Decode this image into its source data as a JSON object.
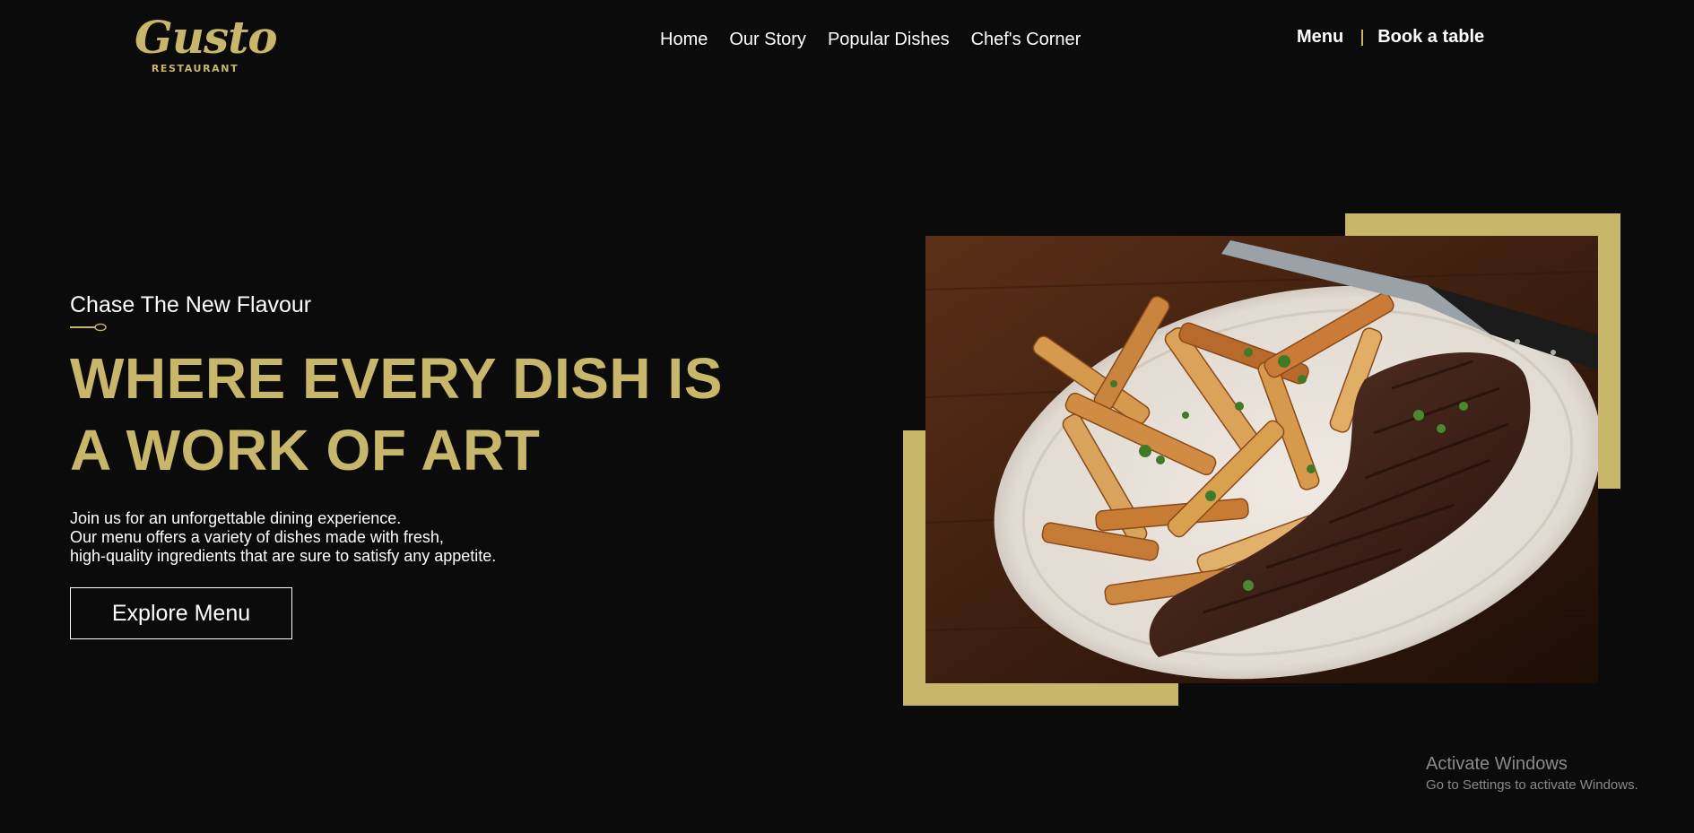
{
  "brand": {
    "name": "Gusto",
    "subtitle": "RESTAURANT",
    "accent_color": "#c8b76a",
    "background_color": "#0b0b0b"
  },
  "nav": {
    "items": [
      {
        "label": "Home"
      },
      {
        "label": "Our Story"
      },
      {
        "label": "Popular Dishes"
      },
      {
        "label": "Chef's Corner"
      }
    ]
  },
  "header_actions": {
    "menu_label": "Menu",
    "book_label": "Book a table"
  },
  "hero": {
    "tagline": "Chase The New Flavour",
    "headline_line1": "WHERE EVERY DISH IS",
    "headline_line2": "A WORK OF ART",
    "description_line1": "Join us for an unforgettable dining experience.",
    "description_line2": "Our menu offers a variety of dishes made with fresh,",
    "description_line3": "high-quality ingredients that are sure to satisfy any appetite.",
    "cta_label": "Explore Menu",
    "divider_icon": "spoon-icon",
    "image_icon": "steak-and-fries-photo"
  },
  "watermark": {
    "title": "Activate Windows",
    "subtitle": "Go to Settings to activate Windows."
  }
}
